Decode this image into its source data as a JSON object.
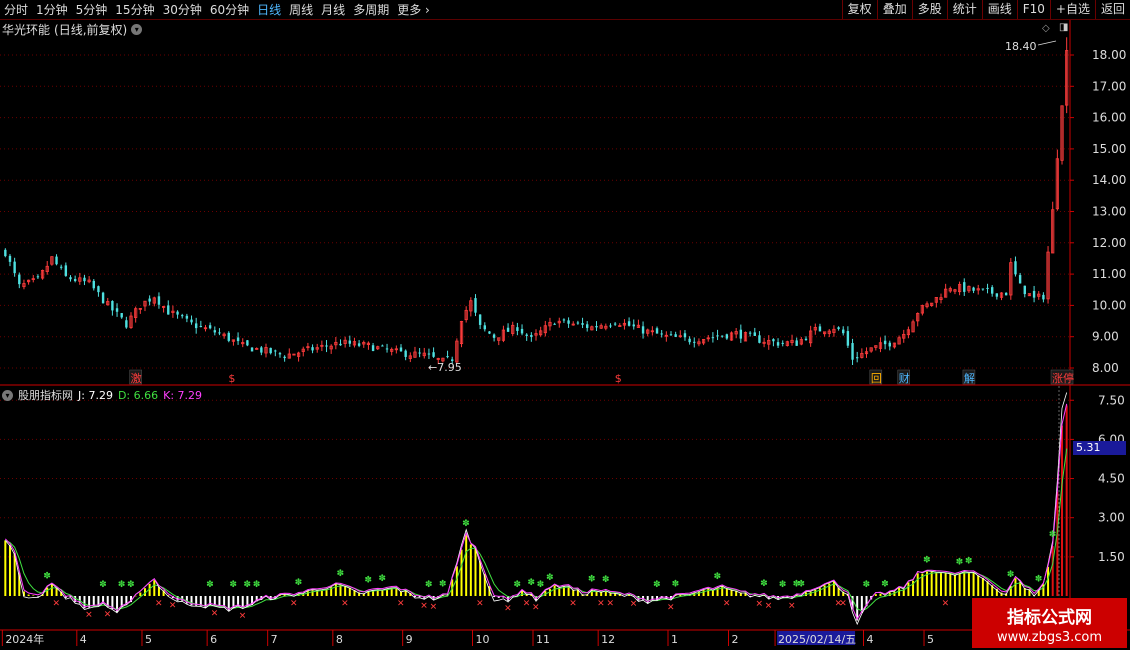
{
  "toolbar": {
    "periods": [
      {
        "label": "分时",
        "active": false
      },
      {
        "label": "1分钟",
        "active": false
      },
      {
        "label": "5分钟",
        "active": false
      },
      {
        "label": "15分钟",
        "active": false
      },
      {
        "label": "30分钟",
        "active": false
      },
      {
        "label": "60分钟",
        "active": false
      },
      {
        "label": "日线",
        "active": true
      },
      {
        "label": "周线",
        "active": false
      },
      {
        "label": "月线",
        "active": false
      },
      {
        "label": "多周期",
        "active": false
      },
      {
        "label": "更多",
        "active": false
      }
    ],
    "tools": [
      "复权",
      "叠加",
      "多股",
      "统计",
      "画线",
      "F10",
      "+自选",
      "返回"
    ]
  },
  "stock": {
    "name": "华光环能",
    "mode": "(日线,前复权)"
  },
  "indicator": {
    "name": "股朋指标网",
    "j_label": "J: 7.29",
    "d_label": "D: 6.66",
    "k_label": "K: 7.29"
  },
  "colors": {
    "up": "#ff3c3c",
    "down": "#4fe0e0",
    "grid": "#6a0000",
    "axis": "#cc0000",
    "k_line": "#ff40ff",
    "d_line": "#40e040",
    "j_line": "#ffffff",
    "yellow_bar": "#ffff00",
    "white_bar": "#ffffff",
    "red_bar": "#e01010"
  },
  "chart_data": {
    "type": "candlestick",
    "price_axis": {
      "ticks": [
        8.0,
        9.0,
        10.0,
        11.0,
        12.0,
        13.0,
        14.0,
        15.0,
        16.0,
        17.0,
        18.0
      ],
      "range": [
        7.6,
        18.9
      ]
    },
    "indicator_axis": {
      "ticks": [
        1.5,
        3.0,
        4.5,
        6.0,
        7.5
      ],
      "range": [
        -1.0,
        7.8
      ]
    },
    "crosshair_value": "5.31",
    "annotations": {
      "high": "18.40",
      "low": "7.95"
    },
    "date_axis": {
      "labels": [
        "2024年",
        "4",
        "5",
        "6",
        "7",
        "8",
        "9",
        "10",
        "11",
        "12",
        "1",
        "2",
        "2025/02/14/五",
        "4",
        "5"
      ],
      "positions": [
        0,
        16,
        30,
        44,
        57,
        71,
        86,
        101,
        114,
        128,
        143,
        156,
        166,
        185,
        198
      ]
    },
    "event_markers": [
      {
        "label": "激",
        "bar": 28
      },
      {
        "label": "$",
        "bar": 49
      },
      {
        "label": "$",
        "bar": 132
      },
      {
        "label": "回",
        "bar": 187
      },
      {
        "label": "财",
        "bar": 193
      },
      {
        "label": "解",
        "bar": 207
      },
      {
        "label": "涨停",
        "bar": 227
      }
    ],
    "price_keypoints": [
      [
        0,
        11.7
      ],
      [
        3,
        10.6
      ],
      [
        7,
        10.8
      ],
      [
        10,
        11.5
      ],
      [
        13,
        10.9
      ],
      [
        18,
        10.7
      ],
      [
        22,
        10.0
      ],
      [
        26,
        9.4
      ],
      [
        29,
        10.0
      ],
      [
        32,
        10.3
      ],
      [
        35,
        9.8
      ],
      [
        40,
        9.4
      ],
      [
        46,
        9.1
      ],
      [
        51,
        8.7
      ],
      [
        60,
        8.4
      ],
      [
        66,
        8.6
      ],
      [
        72,
        8.8
      ],
      [
        78,
        8.7
      ],
      [
        84,
        8.5
      ],
      [
        90,
        8.4
      ],
      [
        94,
        8.2
      ],
      [
        96,
        8.3
      ],
      [
        98,
        9.6
      ],
      [
        100,
        10.1
      ],
      [
        102,
        9.3
      ],
      [
        105,
        9.0
      ],
      [
        110,
        9.3
      ],
      [
        113,
        8.9
      ],
      [
        118,
        9.5
      ],
      [
        122,
        9.4
      ],
      [
        126,
        9.3
      ],
      [
        131,
        9.5
      ],
      [
        137,
        9.2
      ],
      [
        142,
        9.0
      ],
      [
        147,
        8.9
      ],
      [
        152,
        9.0
      ],
      [
        157,
        9.1
      ],
      [
        162,
        8.9
      ],
      [
        166,
        8.8
      ],
      [
        170,
        8.8
      ],
      [
        174,
        9.2
      ],
      [
        178,
        9.3
      ],
      [
        180,
        9.1
      ],
      [
        182,
        8.3
      ],
      [
        186,
        8.6
      ],
      [
        190,
        8.8
      ],
      [
        193,
        9.1
      ],
      [
        196,
        9.8
      ],
      [
        199,
        10.1
      ],
      [
        203,
        10.6
      ],
      [
        207,
        10.5
      ],
      [
        212,
        10.4
      ],
      [
        215,
        10.4
      ],
      [
        216,
        11.3
      ],
      [
        218,
        10.6
      ],
      [
        221,
        10.2
      ],
      [
        223,
        10.3
      ],
      [
        224,
        11.7
      ],
      [
        225,
        13.0
      ],
      [
        226,
        14.8
      ],
      [
        227,
        16.5
      ],
      [
        228,
        18.1
      ]
    ],
    "kdj_keypoints": [
      [
        0,
        2.2
      ],
      [
        2,
        1.6
      ],
      [
        4,
        0.2
      ],
      [
        6,
        0.0
      ],
      [
        8,
        0.1
      ],
      [
        10,
        0.5
      ],
      [
        12,
        0.1
      ],
      [
        15,
        -0.2
      ],
      [
        18,
        -0.5
      ],
      [
        21,
        -0.3
      ],
      [
        24,
        -0.6
      ],
      [
        27,
        -0.3
      ],
      [
        29,
        0.2
      ],
      [
        32,
        0.6
      ],
      [
        34,
        0.2
      ],
      [
        37,
        -0.2
      ],
      [
        40,
        -0.3
      ],
      [
        44,
        -0.4
      ],
      [
        48,
        -0.5
      ],
      [
        52,
        -0.4
      ],
      [
        56,
        -0.1
      ],
      [
        60,
        0.0
      ],
      [
        64,
        0.1
      ],
      [
        68,
        0.3
      ],
      [
        72,
        0.4
      ],
      [
        76,
        0.1
      ],
      [
        80,
        0.2
      ],
      [
        84,
        0.3
      ],
      [
        88,
        0.0
      ],
      [
        92,
        -0.1
      ],
      [
        95,
        0.0
      ],
      [
        97,
        1.2
      ],
      [
        99,
        2.3
      ],
      [
        101,
        1.8
      ],
      [
        103,
        0.9
      ],
      [
        105,
        0.0
      ],
      [
        108,
        -0.2
      ],
      [
        111,
        0.2
      ],
      [
        114,
        -0.1
      ],
      [
        117,
        0.3
      ],
      [
        120,
        0.4
      ],
      [
        124,
        0.1
      ],
      [
        127,
        0.2
      ],
      [
        130,
        0.1
      ],
      [
        134,
        0.0
      ],
      [
        138,
        -0.2
      ],
      [
        142,
        -0.1
      ],
      [
        146,
        0.0
      ],
      [
        150,
        0.2
      ],
      [
        154,
        0.3
      ],
      [
        158,
        0.1
      ],
      [
        162,
        0.0
      ],
      [
        166,
        -0.1
      ],
      [
        170,
        0.0
      ],
      [
        174,
        0.3
      ],
      [
        178,
        0.5
      ],
      [
        181,
        0.1
      ],
      [
        183,
        -1.0
      ],
      [
        185,
        -0.4
      ],
      [
        187,
        0.0
      ],
      [
        190,
        0.1
      ],
      [
        193,
        0.3
      ],
      [
        196,
        0.8
      ],
      [
        199,
        1.0
      ],
      [
        203,
        0.8
      ],
      [
        207,
        0.9
      ],
      [
        210,
        0.7
      ],
      [
        213,
        0.3
      ],
      [
        215,
        0.1
      ],
      [
        217,
        0.7
      ],
      [
        219,
        0.3
      ],
      [
        221,
        0.1
      ],
      [
        223,
        0.4
      ],
      [
        225,
        1.9
      ],
      [
        226,
        4.0
      ],
      [
        227,
        6.5
      ],
      [
        228,
        7.3
      ]
    ]
  }
}
